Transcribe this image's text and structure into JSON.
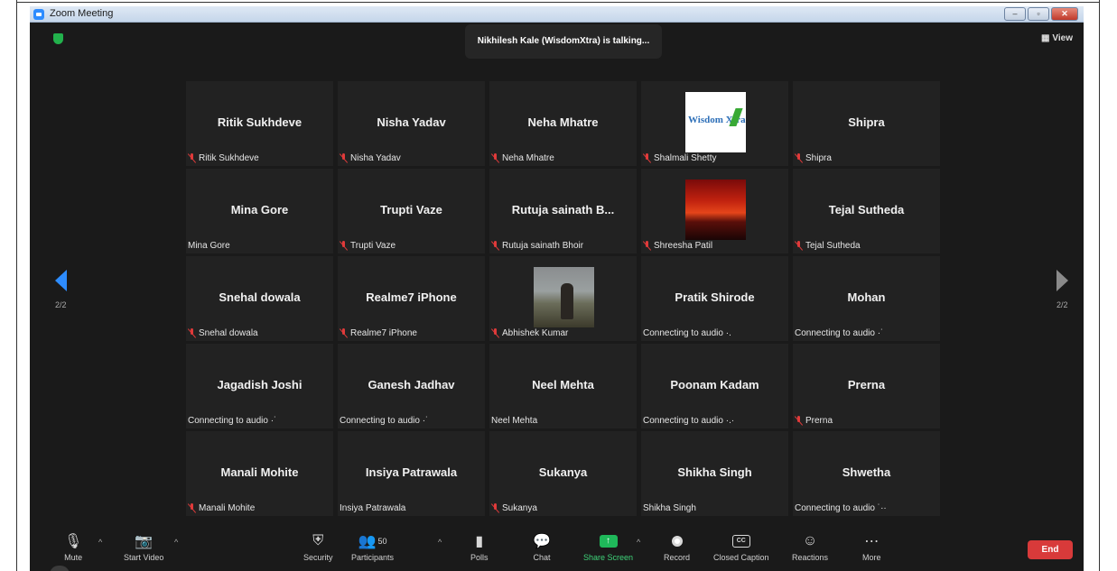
{
  "window": {
    "title": "Zoom Meeting",
    "controls": [
      "minimize",
      "maximize",
      "close"
    ]
  },
  "meeting": {
    "talking_banner": "Nikhilesh Kale (WisdomXtra) is talking...",
    "view_label": "View",
    "page_left": "2/2",
    "page_right": "2/2"
  },
  "participants": [
    {
      "display": "Ritik Sukhdeve",
      "label": "Ritik Sukhdeve",
      "muted": true,
      "media": "name"
    },
    {
      "display": "Nisha Yadav",
      "label": "Nisha Yadav",
      "muted": true,
      "media": "name"
    },
    {
      "display": "Neha Mhatre",
      "label": "Neha Mhatre",
      "muted": true,
      "media": "name"
    },
    {
      "display": "",
      "label": "Shalmali Shetty",
      "muted": true,
      "media": "logo",
      "logo_text": "Wisdom Xtra"
    },
    {
      "display": "Shipra",
      "label": "Shipra",
      "muted": true,
      "media": "name"
    },
    {
      "display": "Mina Gore",
      "label": "Mina Gore",
      "muted": false,
      "media": "name"
    },
    {
      "display": "Trupti Vaze",
      "label": "Trupti Vaze",
      "muted": true,
      "media": "name"
    },
    {
      "display": "Rutuja sainath B...",
      "label": "Rutuja sainath Bhoir",
      "muted": true,
      "media": "name"
    },
    {
      "display": "",
      "label": "Shreesha Patil",
      "muted": true,
      "media": "sunset"
    },
    {
      "display": "Tejal Sutheda",
      "label": "Tejal Sutheda",
      "muted": true,
      "media": "name"
    },
    {
      "display": "Snehal dowala",
      "label": "Snehal dowala",
      "muted": true,
      "media": "name"
    },
    {
      "display": "Realme7 iPhone",
      "label": "Realme7 iPhone",
      "muted": true,
      "media": "name"
    },
    {
      "display": "",
      "label": "Abhishek Kumar",
      "muted": true,
      "media": "photo"
    },
    {
      "display": "Pratik Shirode",
      "label": "Connecting to audio ·.",
      "muted": false,
      "media": "name"
    },
    {
      "display": "Mohan",
      "label": "Connecting to audio ·˙",
      "muted": false,
      "media": "name"
    },
    {
      "display": "Jagadish Joshi",
      "label": "Connecting to audio ·˙",
      "muted": false,
      "media": "name"
    },
    {
      "display": "Ganesh Jadhav",
      "label": "Connecting to audio ·˙",
      "muted": false,
      "media": "name"
    },
    {
      "display": "Neel Mehta",
      "label": "Neel Mehta",
      "muted": false,
      "media": "name"
    },
    {
      "display": "Poonam Kadam",
      "label": "Connecting to audio ·.·",
      "muted": false,
      "media": "name"
    },
    {
      "display": "Prerna",
      "label": "Prerna",
      "muted": true,
      "media": "name"
    },
    {
      "display": "Manali Mohite",
      "label": "Manali Mohite",
      "muted": true,
      "media": "name"
    },
    {
      "display": "Insiya Patrawala",
      "label": "Insiya Patrawala",
      "muted": false,
      "media": "name"
    },
    {
      "display": "Sukanya",
      "label": "Sukanya",
      "muted": true,
      "media": "name"
    },
    {
      "display": "Shikha Singh",
      "label": "Shikha Singh",
      "muted": false,
      "media": "name"
    },
    {
      "display": "Shwetha",
      "label": "Connecting to audio ˙··",
      "muted": false,
      "media": "name"
    }
  ],
  "toolbar": {
    "mute": "Mute",
    "start_video": "Start Video",
    "security": "Security",
    "participants": "Participants",
    "participants_count": "50",
    "polls": "Polls",
    "chat": "Chat",
    "share_screen": "Share Screen",
    "record": "Record",
    "closed_caption": "Closed Caption",
    "cc_glyph": "CC",
    "reactions": "Reactions",
    "more": "More",
    "end": "End"
  },
  "colors": {
    "accent": "#2d8cff",
    "end": "#d83a3a",
    "share": "#1fb85a",
    "tile": "#222222",
    "background": "#1a1a1a"
  }
}
